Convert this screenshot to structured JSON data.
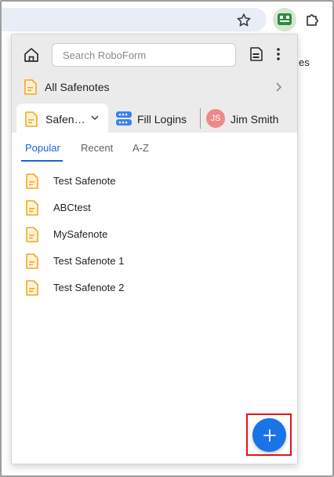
{
  "page": {
    "snippet_text": "es"
  },
  "popup": {
    "search": {
      "placeholder": "Search RoboForm",
      "value": ""
    },
    "all_safenotes_label": "All Safenotes",
    "active_tab_label": "Safen…",
    "fill_logins_label": "Fill Logins",
    "user": {
      "initials": "JS",
      "name": "Jim Smith"
    },
    "subtabs": [
      {
        "label": "Popular",
        "active": true
      },
      {
        "label": "Recent",
        "active": false
      },
      {
        "label": "A-Z",
        "active": false
      }
    ],
    "items": [
      {
        "label": "Test Safenote"
      },
      {
        "label": "ABCtest"
      },
      {
        "label": "MySafenote"
      },
      {
        "label": "Test Safenote 1"
      },
      {
        "label": "Test Safenote 2"
      }
    ],
    "fab_icon": "plus-icon",
    "colors": {
      "accent": "#1b73e8",
      "highlight": "#e0141b",
      "note_icon": "#f2a825",
      "avatar": "#ef8a87"
    }
  }
}
